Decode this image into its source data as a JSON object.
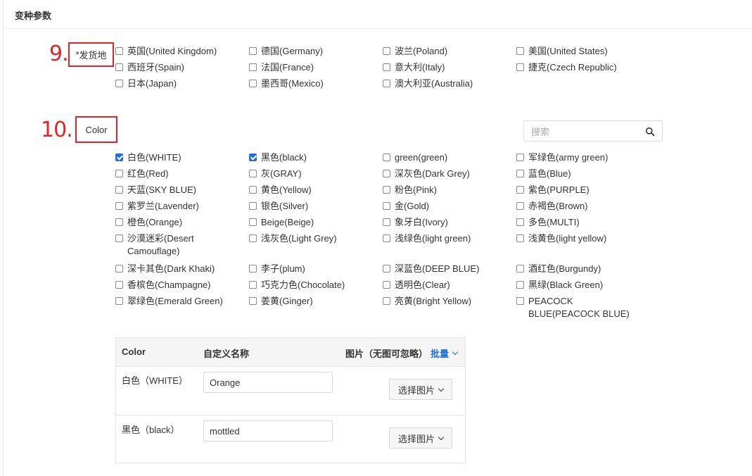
{
  "header": {
    "title": "变种参数"
  },
  "annotations": {
    "nine": "9.",
    "ten": "10."
  },
  "ship_from": {
    "required_mark": "*",
    "label": "发货地",
    "options": [
      {
        "label": "英国(United Kingdom)",
        "checked": false
      },
      {
        "label": "德国(Germany)",
        "checked": false
      },
      {
        "label": "波兰(Poland)",
        "checked": false
      },
      {
        "label": "美国(United States)",
        "checked": false
      },
      {
        "label": "西班牙(Spain)",
        "checked": false
      },
      {
        "label": "法国(France)",
        "checked": false
      },
      {
        "label": "意大利(Italy)",
        "checked": false
      },
      {
        "label": "捷克(Czech Republic)",
        "checked": false
      },
      {
        "label": "日本(Japan)",
        "checked": false
      },
      {
        "label": "墨西哥(Mexico)",
        "checked": false
      },
      {
        "label": "澳大利亚(Australia)",
        "checked": false
      }
    ]
  },
  "color": {
    "label": "Color",
    "search_placeholder": "搜索",
    "options": [
      {
        "label": "白色(WHITE)",
        "checked": true
      },
      {
        "label": "黑色(black)",
        "checked": true
      },
      {
        "label": "green(green)",
        "checked": false
      },
      {
        "label": "军绿色(army green)",
        "checked": false
      },
      {
        "label": "红色(Red)",
        "checked": false
      },
      {
        "label": "灰(GRAY)",
        "checked": false
      },
      {
        "label": "深灰色(Dark Grey)",
        "checked": false
      },
      {
        "label": "蓝色(Blue)",
        "checked": false
      },
      {
        "label": "天蓝(SKY BLUE)",
        "checked": false
      },
      {
        "label": "黄色(Yellow)",
        "checked": false
      },
      {
        "label": "粉色(Pink)",
        "checked": false
      },
      {
        "label": "紫色(PURPLE)",
        "checked": false
      },
      {
        "label": "紫罗兰(Lavender)",
        "checked": false
      },
      {
        "label": "银色(Silver)",
        "checked": false
      },
      {
        "label": "金(Gold)",
        "checked": false
      },
      {
        "label": "赤褐色(Brown)",
        "checked": false
      },
      {
        "label": "橙色(Orange)",
        "checked": false
      },
      {
        "label": "Beige(Beige)",
        "checked": false
      },
      {
        "label": "象牙白(Ivory)",
        "checked": false
      },
      {
        "label": "多色(MULTI)",
        "checked": false
      },
      {
        "label": "沙漠迷彩(Desert Camouflage)",
        "checked": false
      },
      {
        "label": "浅灰色(Light Grey)",
        "checked": false
      },
      {
        "label": "浅绿色(light green)",
        "checked": false
      },
      {
        "label": "浅黄色(light yellow)",
        "checked": false
      },
      {
        "label": "深卡其色(Dark Khaki)",
        "checked": false
      },
      {
        "label": "李子(plum)",
        "checked": false
      },
      {
        "label": "深蓝色(DEEP BLUE)",
        "checked": false
      },
      {
        "label": "酒红色(Burgundy)",
        "checked": false
      },
      {
        "label": "香槟色(Champagne)",
        "checked": false
      },
      {
        "label": "巧克力色(Chocolate)",
        "checked": false
      },
      {
        "label": "透明色(Clear)",
        "checked": false
      },
      {
        "label": "黑绿(Black Green)",
        "checked": false
      },
      {
        "label": "翠绿色(Emerald Green)",
        "checked": false
      },
      {
        "label": "姜黄(Ginger)",
        "checked": false
      },
      {
        "label": "亮黄(Bright Yellow)",
        "checked": false
      },
      {
        "label": "PEACOCK BLUE(PEACOCK BLUE)",
        "checked": false
      }
    ]
  },
  "variant_table": {
    "columns": {
      "color": "Color",
      "custom_name": "自定义名称",
      "image": "图片（无图可忽略）",
      "bulk": "批量"
    },
    "rows": [
      {
        "color": "白色（WHITE）",
        "custom_name": "Orange",
        "image_button": "选择图片"
      },
      {
        "color": "黑色（black）",
        "custom_name": "mottled",
        "image_button": "选择图片"
      }
    ]
  },
  "colors": {
    "annotation_red": "#e0242a",
    "accent_blue": "#1e6fd9"
  }
}
